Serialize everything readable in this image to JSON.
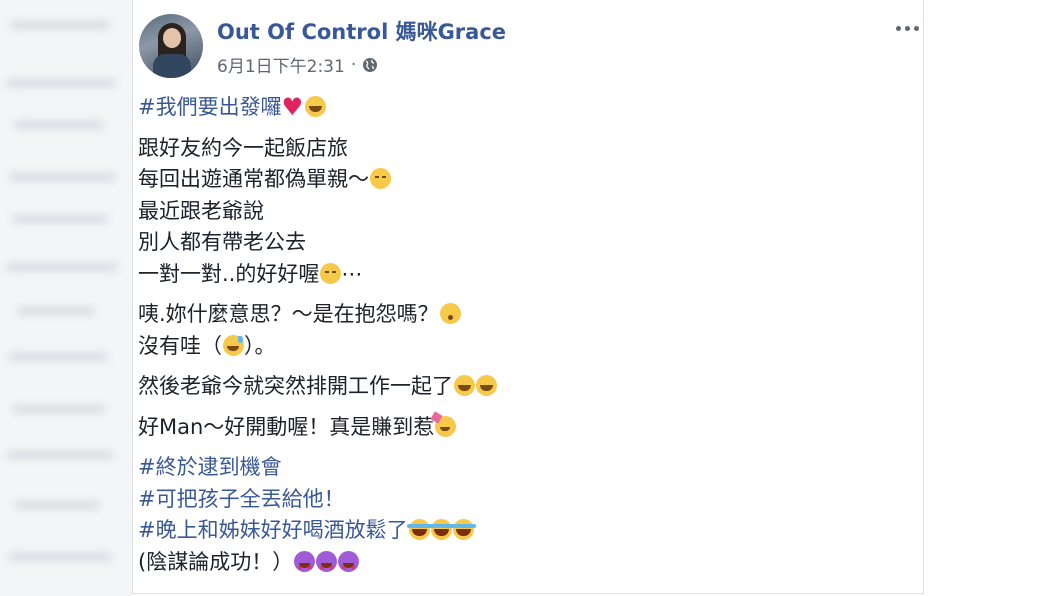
{
  "post": {
    "author": "Out Of Control 媽咪Grace",
    "timestamp": "6月1日下午2:31",
    "separator": "·",
    "privacy_icon": "globe-icon",
    "more_icon": "more-options-icon",
    "paragraphs": [
      {
        "lines": [
          {
            "text": "#我們要出發囉",
            "tag": true,
            "emoji": [
              "heart",
              "grin"
            ]
          }
        ]
      },
      {
        "lines": [
          {
            "text": "跟好友約今一起飯店旅",
            "emoji": []
          },
          {
            "text": "每回出遊通常都偽單親～",
            "emoji": [
              "sad"
            ]
          },
          {
            "text": "最近跟老爺說",
            "emoji": []
          },
          {
            "text": "別人都有帶老公去",
            "emoji": []
          },
          {
            "text": "一對一對..的好好喔",
            "emoji": [
              "sad"
            ],
            "suffix": "⋯"
          }
        ]
      },
      {
        "lines": [
          {
            "text": "咦.妳什麼意思？～是在抱怨嗎？",
            "emoji": [
              "worried"
            ]
          },
          {
            "text": "沒有哇（",
            "emoji": [
              "sweat"
            ],
            "suffix": "）。"
          }
        ]
      },
      {
        "lines": [
          {
            "text": "然後老爺今就突然排開工作一起了",
            "emoji": [
              "grin",
              "grin"
            ]
          }
        ]
      },
      {
        "lines": [
          {
            "text": "好Man～好開動喔！真是賺到惹",
            "emoji": [
              "party"
            ]
          }
        ]
      },
      {
        "lines": [
          {
            "text": "#終於逮到機會",
            "tag": true,
            "emoji": []
          },
          {
            "text": "#可把孩子全丟給他！",
            "tag": true,
            "emoji": []
          },
          {
            "text": "#晚上和姊妹好好喝酒放鬆了",
            "tag": true,
            "emoji": [
              "cry",
              "cry",
              "cry"
            ]
          },
          {
            "text": "(陰謀論成功！）",
            "emoji": [
              "star",
              "star",
              "star"
            ]
          }
        ]
      }
    ]
  },
  "colors": {
    "link": "#385898",
    "text": "#1d2129",
    "meta": "#616770"
  }
}
